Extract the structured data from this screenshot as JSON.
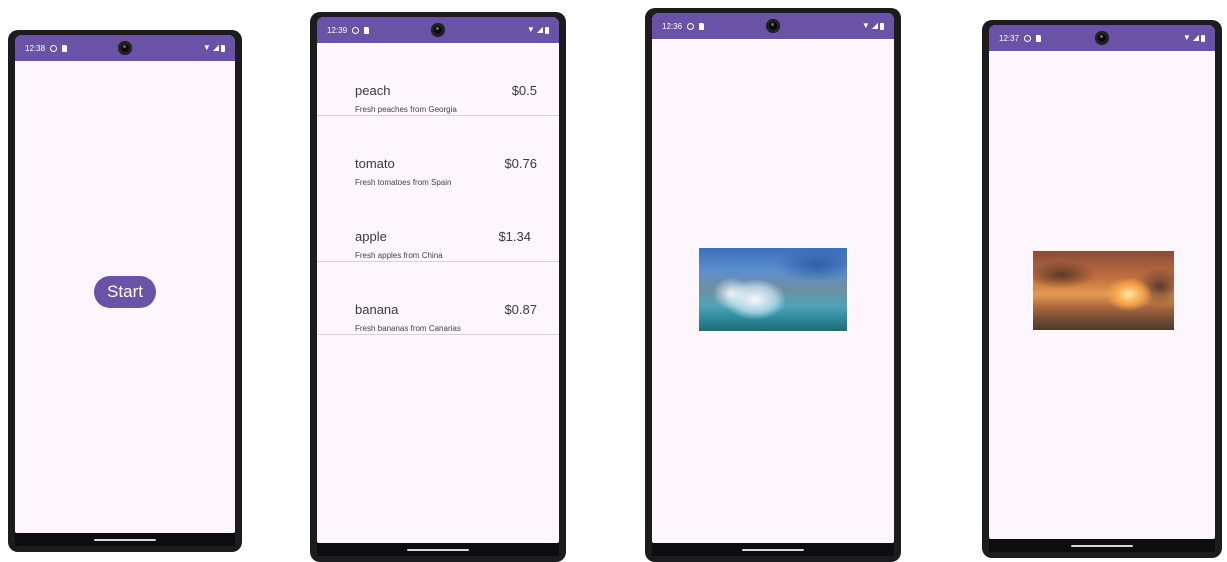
{
  "screens": [
    {
      "time": "12:38",
      "button_label": "Start"
    },
    {
      "time": "12:39",
      "products": [
        {
          "name": "peach",
          "price": "$0.5",
          "description": "Fresh peaches from Georgia"
        },
        {
          "name": "tomato",
          "price": "$0.76",
          "description": "Fresh tomatoes from Spain"
        },
        {
          "name": "apple",
          "price": "$1.34",
          "description": "Fresh apples from China"
        },
        {
          "name": "banana",
          "price": "$0.87",
          "description": "Fresh bananas from Canarias"
        }
      ]
    },
    {
      "time": "12:36"
    },
    {
      "time": "12:37"
    }
  ],
  "colors": {
    "accent": "#6a52a6",
    "background": "#fdf7fd",
    "frame": "#1c1c1e"
  },
  "icons": [
    "shield-icon",
    "sim-card-icon",
    "camera-cutout-icon",
    "wifi-icon",
    "signal-icon",
    "battery-icon"
  ]
}
